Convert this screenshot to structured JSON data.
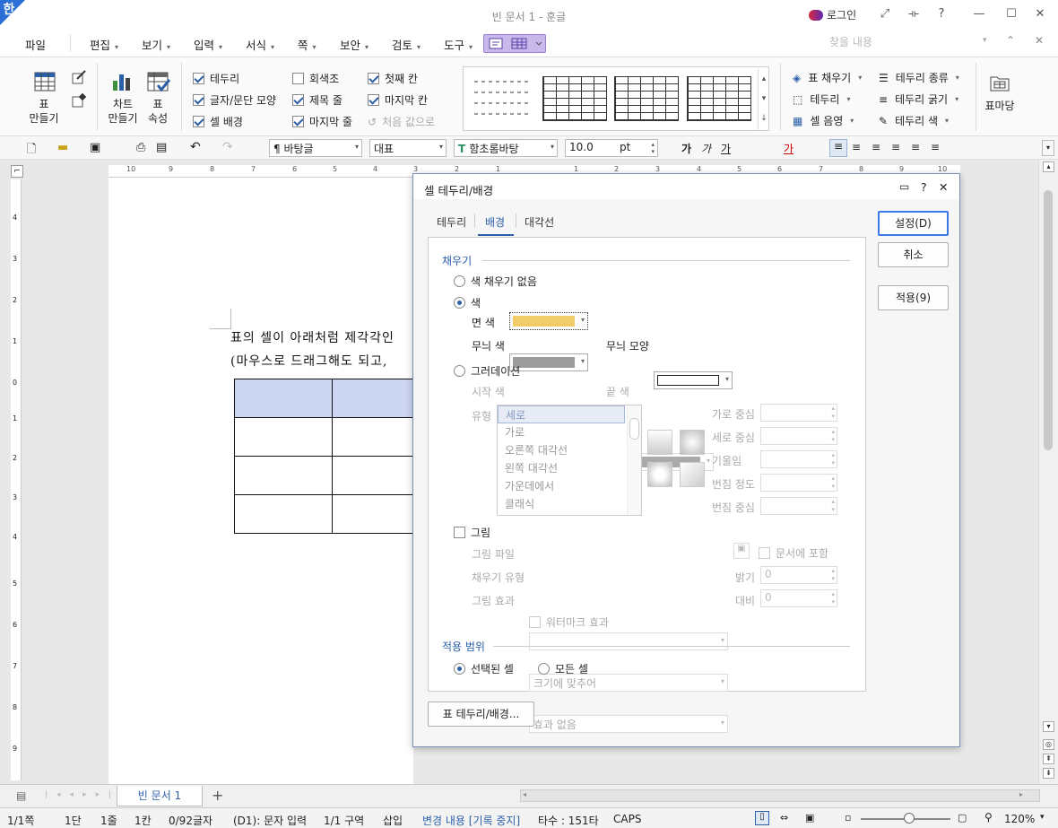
{
  "window": {
    "app_icon": "한",
    "title": "빈 문서 1 - 훈글",
    "login": "로그인",
    "controls": [
      "⤢",
      "⟛",
      "?",
      "—",
      "☐",
      "✕"
    ]
  },
  "menubar": {
    "items": [
      "파일",
      "편집",
      "보기",
      "입력",
      "서식",
      "쪽",
      "보안",
      "검토",
      "도구"
    ],
    "search_placeholder": "찾을 내용"
  },
  "ribbon": {
    "table_make": "표\n만들기",
    "chart_make": "차트\n만들기",
    "table_props": "표\n속성",
    "checks_col1": [
      {
        "label": "테두리",
        "checked": true
      },
      {
        "label": "글자/문단 모양",
        "checked": true
      },
      {
        "label": "셀 배경",
        "checked": true
      }
    ],
    "checks_col2": [
      {
        "label": "회색조",
        "checked": false
      },
      {
        "label": "제목 줄",
        "checked": true
      },
      {
        "label": "마지막 줄",
        "checked": true
      }
    ],
    "checks_col3": [
      {
        "label": "첫째 칸",
        "checked": true
      },
      {
        "label": "마지막 칸",
        "checked": true
      },
      {
        "label": "처음 값으로",
        "checked": false
      }
    ],
    "right_col1": [
      "표 채우기",
      "테두리",
      "셀 음영"
    ],
    "right_col2": [
      "테두리 종류",
      "테두리 굵기",
      "테두리 색"
    ],
    "table_mark": "표마당"
  },
  "toolbar": {
    "style": "바탕글",
    "lang": "대표",
    "font": "함초롬바탕",
    "size": "10.0",
    "unit": "pt",
    "char_buttons": [
      "가",
      "가",
      "가",
      "가"
    ]
  },
  "document": {
    "line1": "표의 셀이 아래처럼 제각각인",
    "line2": "(마우스로 드래그해도 되고,"
  },
  "ruler": {
    "h_ticks": [
      "10",
      "9",
      "8",
      "7",
      "6",
      "5",
      "4",
      "3",
      "2",
      "1",
      "1",
      "2",
      "3",
      "4",
      "5",
      "6",
      "7",
      "8",
      "9",
      "10"
    ],
    "v_ticks": [
      "4",
      "3",
      "2",
      "1",
      "0",
      "1",
      "2",
      "3",
      "4",
      "5",
      "6",
      "7",
      "8",
      "9"
    ]
  },
  "dialog": {
    "title": "셀 테두리/배경",
    "title_icons": [
      "▭",
      "?",
      "✕"
    ],
    "tabs": [
      "테두리",
      "배경",
      "대각선"
    ],
    "active_tab": "배경",
    "fill_section": "채우기",
    "no_fill": "색 채우기 없음",
    "color_option": "색",
    "face_color": "면 색",
    "face_color_value": "#f0cd6a",
    "pattern_color": "무늬 색",
    "pattern_color_value": "#9c9c9c",
    "pattern_shape": "무늬 모양",
    "gradation": "그러데이션",
    "start_color": "시작 색",
    "end_color": "끝 색",
    "type_label": "유형",
    "gradient_types": [
      "세로",
      "가로",
      "오른쪽 대각선",
      "왼쪽 대각선",
      "가운데에서",
      "클래식"
    ],
    "h_center": "가로 중심",
    "v_center": "세로 중심",
    "slope": "기울임",
    "blur_degree": "번짐 정도",
    "blur_center": "번짐 중심",
    "picture": "그림",
    "picture_file": "그림 파일",
    "fill_type": "채우기 유형",
    "fill_type_value": "크기에 맞추어",
    "picture_effect": "그림 효과",
    "picture_effect_value": "효과 없음",
    "include_doc": "문서에 포함",
    "brightness": "밝기",
    "brightness_value": "0",
    "contrast": "대비",
    "contrast_value": "0",
    "watermark": "워터마크 효과",
    "scope_section": "적용 범위",
    "scope_selected": "선택된 셀",
    "scope_all": "모든 셀",
    "btn_ok": "설정(D)",
    "btn_cancel": "취소",
    "btn_apply": "적용(9)",
    "btn_table_border": "표 테두리/배경..."
  },
  "tabs": {
    "doc_tab": "빈 문서 1",
    "add": "+"
  },
  "status": {
    "items": [
      "1/1쪽",
      "1단",
      "1줄",
      "1칸",
      "0/92글자",
      "(D1): 문자 입력",
      "1/1 구역",
      "삽입",
      "변경 내용 [기록 중지]",
      "타수 : 151타",
      "CAPS"
    ],
    "zoom": "120%"
  },
  "colors": {
    "accent": "#2b5fa8",
    "header_cell": "#ccd6f2",
    "face_color": "#f0cd6a"
  }
}
